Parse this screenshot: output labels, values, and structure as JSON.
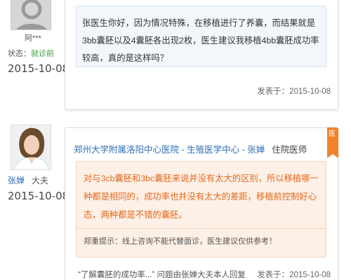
{
  "thread1": {
    "user_name": "阿***",
    "status_label": "状态：",
    "status_value": "就诊前",
    "date": "2015-10-08",
    "message": "张医生你好，因为情况特殊，在移植进行了养囊，而结果就是3bb囊胚以及4囊胚各出现2枚，医生建议我移植4bb囊胚成功率较高，真的是这样吗？",
    "sent_label": "发表于：",
    "sent_date": "2015-10-08"
  },
  "thread2": {
    "doctor_name": "张婵",
    "doctor_title_short": "大夫",
    "date": "2015-10-08",
    "badge": "医",
    "hospital_link": "郑州大学附属洛阳中心医院 - 生殖医学中心 - 张婵",
    "doctor_position": "住院医师",
    "reply": "对与3cb囊胚和3bc囊胚来说并没有太大的区别，所以移植哪一种都是相同的，成功率也并没有太大的差距，移植前控制好心态，两种都是不错的囊胚。",
    "notice": "郑重提示：线上咨询不能代替面诊，医生建议仅供参考！",
    "related": "“了解囊胚的成功率...” 问题由张婵大夫本人回复",
    "sent_label": "发表于：",
    "sent_date": "2015-10-08"
  },
  "colors": {
    "link_blue": "#2f6fb8",
    "reply_orange": "#e46a1e",
    "badge_orange": "#f08228",
    "status_green": "#3c9a3c"
  }
}
